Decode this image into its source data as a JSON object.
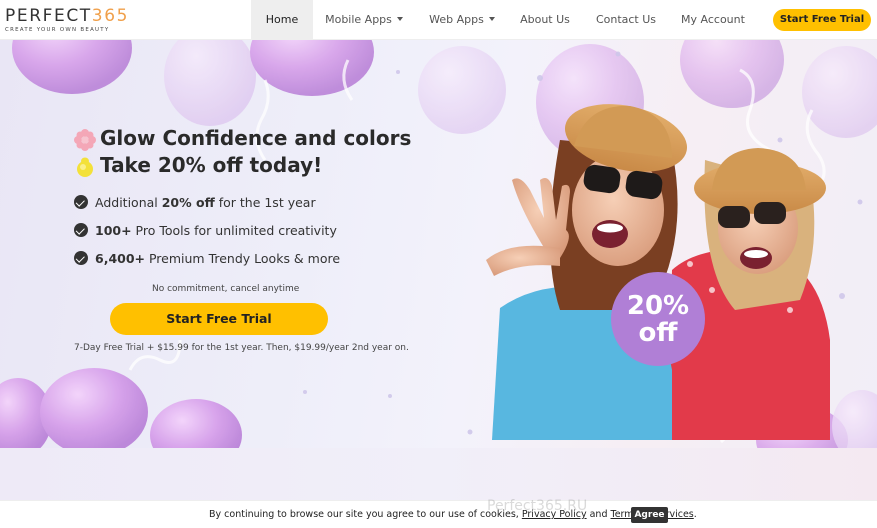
{
  "logo": {
    "brand_text": "PERFECT",
    "brand_number": "365",
    "tagline": "CREATE YOUR OWN BEAUTY"
  },
  "nav": {
    "items": [
      {
        "label": "Home",
        "active": true
      },
      {
        "label": "Mobile Apps",
        "dropdown": true
      },
      {
        "label": "Web Apps",
        "dropdown": true
      },
      {
        "label": "About Us"
      },
      {
        "label": "Contact Us"
      },
      {
        "label": "My Account"
      }
    ],
    "cta_label": "Start Free Trial"
  },
  "hero": {
    "headline_1": "Glow Confidence and colors",
    "headline_2": "Take 20% off today!",
    "headline_1_icon": "sparkle-flower-icon",
    "headline_2_icon": "lemon-icon",
    "bullets": [
      {
        "pre": "Additional ",
        "bold": "20% off",
        "post": " for the 1st year"
      },
      {
        "pre": "",
        "bold": "100+",
        "post": " Pro Tools for unlimited creativity"
      },
      {
        "pre": "",
        "bold": "6,400+",
        "post": " Premium Trendy Looks & more"
      }
    ],
    "commitment_note": "No commitment, cancel anytime",
    "cta_label": "Start Free Trial",
    "pricing_note": "7-Day Free Trial + $15.99 for the 1st year. Then, $19.99/year 2nd year on.",
    "badge_line_1": "20%",
    "badge_line_2": "off"
  },
  "cookie": {
    "text_before": "By continuing to browse our site you agree to our use of cookies, ",
    "privacy_link": "Privacy Policy",
    "text_mid": " and ",
    "terms_link": "Terms of Services",
    "text_after": ".",
    "agree_label": "Agree"
  },
  "watermark": "Perfect365.RU",
  "colors": {
    "accent_yellow": "#ffc000",
    "badge_purple": "#b07fd6",
    "logo_orange": "#f0a04b"
  }
}
